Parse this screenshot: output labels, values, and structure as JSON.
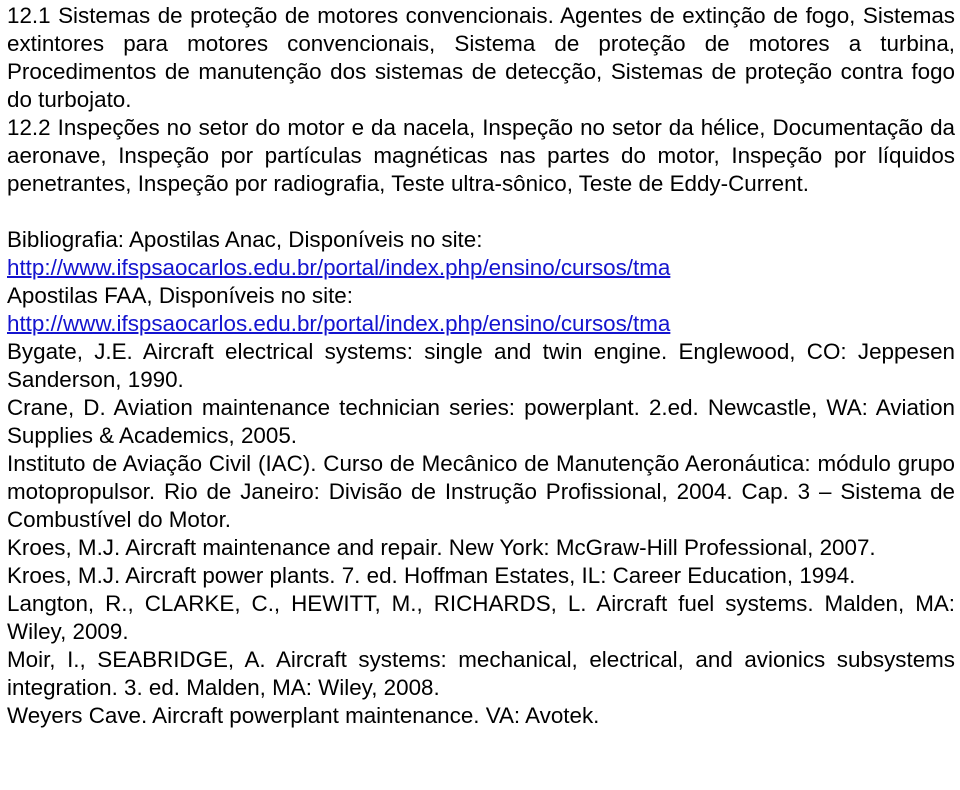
{
  "document": {
    "language": "pt-BR",
    "text_color": "#000000",
    "link_color": "#1414cf",
    "background_color": "#ffffff"
  },
  "sections": [
    {
      "id": "12.1",
      "name": "sistemas-protecao-motores",
      "text": "12.1 Sistemas de proteção de motores convencionais. Agentes de extinção de fogo, Sistemas extintores para motores convencionais, Sistema de proteção de motores a turbina, Procedimentos de manutenção dos sistemas de detecção, Sistemas de proteção contra fogo do turbojato."
    },
    {
      "id": "12.2",
      "name": "inspecoes-motor-nacela",
      "text": "12.2 Inspeções no setor do motor e da nacela, Inspeção no setor da hélice, Documentação da aeronave, Inspeção por partículas magnéticas nas partes do motor, Inspeção por líquidos penetrantes, Inspeção por radiografia, Teste ultra-sônico, Teste de Eddy-Current."
    }
  ],
  "bibliography": {
    "heading_anac": "Bibliografia: Apostilas Anac, Disponíveis no site:",
    "link_anac": "http://www.ifspsaocarlos.edu.br/portal/index.php/ensino/cursos/tma",
    "heading_faa": "Apostilas FAA, Disponíveis no site:",
    "link_faa": "http://www.ifspsaocarlos.edu.br/portal/index.php/ensino/cursos/tma",
    "entries": [
      {
        "name": "reference-bygate",
        "text": "Bygate, J.E. Aircraft electrical systems: single and twin engine. Englewood, CO: Jeppesen Sanderson, 1990."
      },
      {
        "name": "reference-crane",
        "text": "Crane, D. Aviation maintenance technician series: powerplant. 2.ed. Newcastle, WA: Aviation Supplies & Academics, 2005."
      },
      {
        "name": "reference-iac",
        "text": "Instituto de Aviação Civil (IAC). Curso de Mecânico de Manutenção Aeronáutica: módulo grupo motopropulsor. Rio de Janeiro: Divisão de Instrução Profissional, 2004. Cap. 3 – Sistema de Combustível do Motor."
      },
      {
        "name": "reference-kroes-maintenance",
        "text": "Kroes, M.J. Aircraft maintenance and repair. New York: McGraw-Hill Professional, 2007."
      },
      {
        "name": "reference-kroes-powerplants",
        "text": "Kroes, M.J. Aircraft power plants. 7. ed. Hoffman Estates, IL: Career Education, 1994."
      },
      {
        "name": "reference-langton",
        "text": "Langton, R., CLARKE, C., HEWITT, M., RICHARDS, L. Aircraft fuel systems. Malden, MA: Wiley, 2009."
      },
      {
        "name": "reference-moir",
        "text": "Moir, I., SEABRIDGE, A. Aircraft systems: mechanical, electrical, and avionics subsystems integration. 3. ed. Malden, MA: Wiley, 2008."
      },
      {
        "name": "reference-weyers",
        "text": "Weyers Cave. Aircraft powerplant maintenance. VA: Avotek."
      }
    ]
  }
}
